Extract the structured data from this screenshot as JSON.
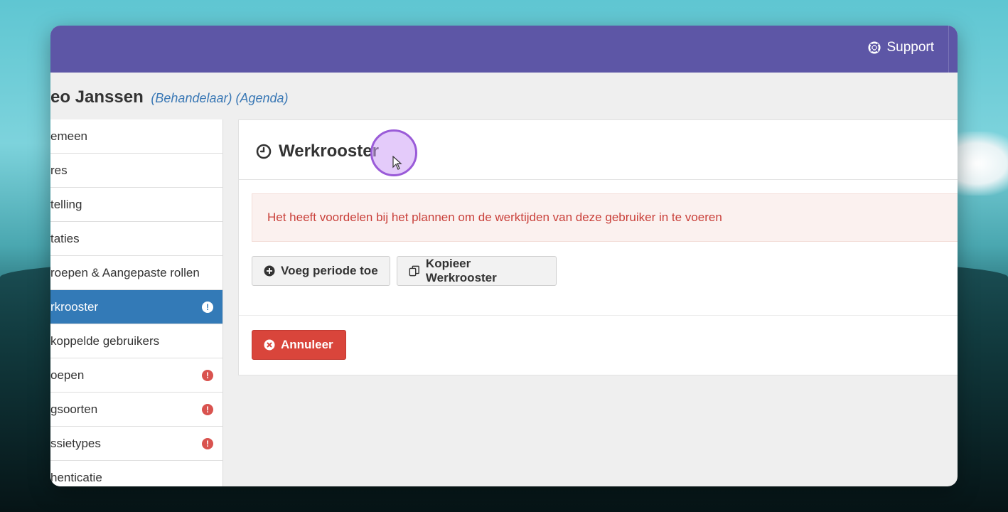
{
  "header": {
    "support_label": "Support"
  },
  "person": {
    "name": "eo Janssen",
    "roles": "(Behandelaar) (Agenda)"
  },
  "sidebar": {
    "items": [
      {
        "label": "emeen",
        "badge": ""
      },
      {
        "label": "res",
        "badge": ""
      },
      {
        "label": "telling",
        "badge": ""
      },
      {
        "label": "taties",
        "badge": ""
      },
      {
        "label": "roepen & Aangepaste rollen",
        "badge": ""
      },
      {
        "label": "rkrooster",
        "badge": "!"
      },
      {
        "label": "koppelde gebruikers",
        "badge": ""
      },
      {
        "label": "oepen",
        "badge": "!"
      },
      {
        "label": "gsoorten",
        "badge": "!"
      },
      {
        "label": "ssietypes",
        "badge": "!"
      },
      {
        "label": "henticatie",
        "badge": ""
      }
    ],
    "active_index": 5
  },
  "panel": {
    "title": "Werkrooster",
    "alert": "Het heeft voordelen bij het plannen om de werktijden van deze gebruiker in te voeren",
    "add_button": "Voeg periode toe",
    "copy_button": "Kopieer Werkrooster",
    "cancel_button": "Annuleer"
  },
  "colors": {
    "topbar": "#5d56a6",
    "active": "#337ab7",
    "danger": "#d9453b",
    "alert_text": "#c9403a",
    "roles_link": "#3a78b5"
  },
  "icons": {
    "support": "lifebuoy-icon",
    "title": "clock-icon",
    "add": "plus-circle-icon",
    "copy": "copy-icon",
    "cancel": "times-circle-icon",
    "badge": "exclamation-icon"
  }
}
